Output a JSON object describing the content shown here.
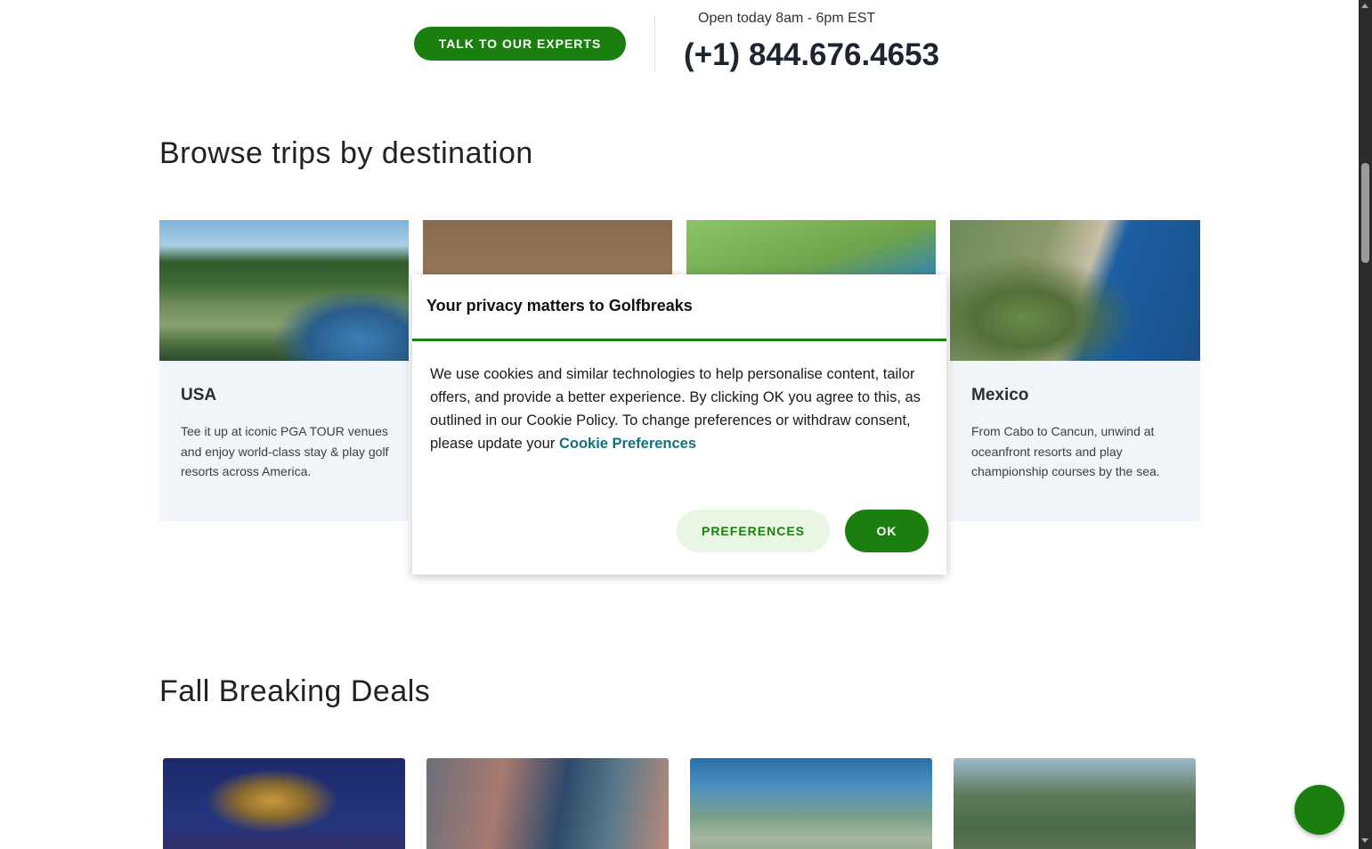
{
  "contact": {
    "talk_button_label": "TALK TO OUR EXPERTS",
    "hours": "Open today 8am - 6pm EST",
    "phone": "(+1) 844.676.4653"
  },
  "destinations": {
    "title": "Browse trips by destination",
    "cards": [
      {
        "name": "USA",
        "description": "Tee it up at iconic PGA TOUR venues and enjoy world-class stay & play golf resorts across America."
      },
      {
        "name": "Mexico",
        "description": "From Cabo to Cancun, unwind at oceanfront resorts and play championship courses by the sea."
      }
    ]
  },
  "deals": {
    "title": "Fall Breaking Deals"
  },
  "cookie_modal": {
    "title": "Your privacy matters to Golfbreaks",
    "body_text": "We use cookies and similar technologies to help personalise content, tailor offers, and provide a better experience. By clicking OK you agree to this, as outlined in our Cookie Policy. To change preferences or withdraw consent, please update your ",
    "link_text": "Cookie Preferences",
    "preferences_button": "PREFERENCES",
    "ok_button": "OK"
  },
  "colors": {
    "brand_green": "#1a7f0f",
    "link_teal": "#14707a",
    "card_bg": "#f1f5fa"
  }
}
